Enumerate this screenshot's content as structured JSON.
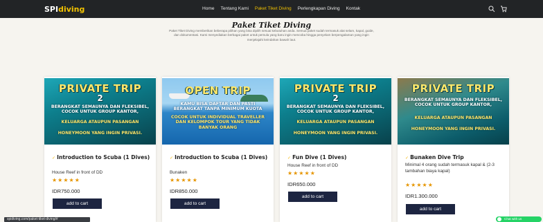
{
  "header": {
    "logo_part1": "SPI",
    "logo_part2": "diving",
    "menu": [
      "Home",
      "Tentang Kami",
      "Paket Tiket Diving",
      "Perlengkapan Diving",
      "Kontak"
    ],
    "active_index": 2,
    "icons": [
      "search-icon",
      "cart-icon"
    ]
  },
  "page": {
    "title": "Paket Tiket Diving",
    "intro": "Paket Tiket Diving memberikan beberapa pilihan yang bisa dipilih sesuai kebutuhan anda. Semua paket sudah termasuk alat selam, kapal, guide, dan dokumentasi. Kami menyediakan berbagai paket untuk pemula yang baru ingin mencoba hingga penyelam berpengalaman yang ingin menjelajahi keindahan bawah laut."
  },
  "products": [
    {
      "image": {
        "type": "private",
        "line1": "PRIVATE TRIP",
        "line2": "2",
        "line3": "BERANGKAT SEMAUNYA DAN FLEKSIBEL, COCOK UNTUK GROUP KANTOR,",
        "line4": "KELUARGA ATAUPUN PASANGAN",
        "line5": "HONEYMOON YANG INGIN PRIVASI."
      },
      "name": "Introduction to Scuba (1 Dives)",
      "description": "House Reef in front of DD",
      "rating": "★★★★★",
      "price": "IDR750.000",
      "cta": "add to cart"
    },
    {
      "image": {
        "type": "open",
        "line1": "OPEN TRIP",
        "line2": "KAMU BISA DAFTAR DAN PASTI BERANGKAT TANPA MINIMUM KUOTA",
        "line3": "COCOK UNTUK INDIVIDUAL TRAVELLER DAN KELOMPOK TOUR YANG TIDAK BANYAK ORANG"
      },
      "name": "Introduction to Scuba (1 Dives)",
      "description": "Bunaken",
      "rating": "★★★★★",
      "price": "IDR850.000",
      "cta": "add to cart"
    },
    {
      "image": {
        "type": "private",
        "line1": "PRIVATE TRIP",
        "line2": "2",
        "line3": "BERANGKAT SEMAUNYA DAN FLEKSIBEL, COCOK UNTUK GROUP KANTOR,",
        "line4": "KELUARGA ATAUPUN PASANGAN",
        "line5": "HONEYMOON YANG INGIN PRIVASI."
      },
      "name": "Fun Dive (1 Dives)",
      "description": "House Reef in front of DD",
      "rating": "★★★★★",
      "price": "IDR650.000",
      "cta": "add to cart"
    },
    {
      "image": {
        "type": "private",
        "line1": "PRIVATE TRIP",
        "line2": "",
        "line3": "BERANGKAT SEMAUNYA DAN FLEKSIBEL, COCOK UNTUK GROUP KANTOR,",
        "line4": "KELUARGA ATAUPUN PASANGAN",
        "line5": "HONEYMOON YANG INGIN PRIVASI."
      },
      "name": "Bunaken Dive Trip",
      "description": "Minimal 4 orang sudah termasuk kapal & (2-3 tambahan biaya kapal)",
      "rating": "★★★★★",
      "price": "IDR1.300.000",
      "cta": "add to cart"
    }
  ],
  "footer": {
    "status_text": "spidiving.com/paket-tiket-diving/#",
    "whatsapp_label": "Chat with us"
  },
  "colors": {
    "nav_bg": "#222426",
    "accent": "#f2c200",
    "button_bg": "#1d2541",
    "star": "#e69500",
    "whatsapp": "#25d366"
  }
}
